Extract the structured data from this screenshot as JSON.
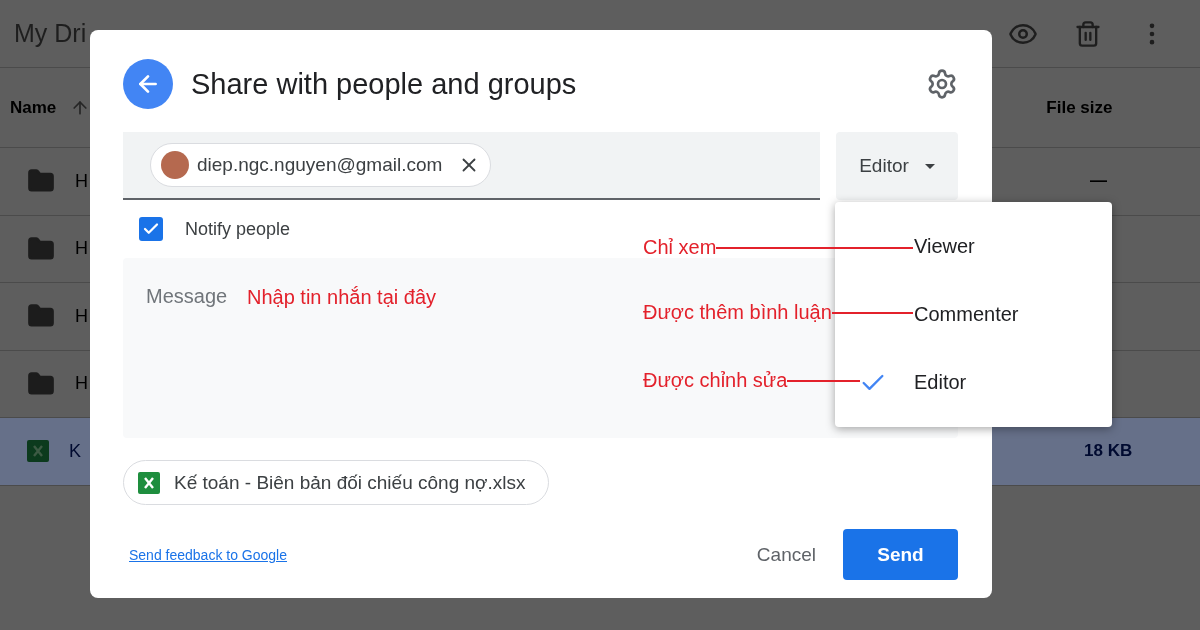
{
  "background": {
    "breadcrumb": "My Dri",
    "columns": {
      "name": "Name",
      "size": "File size"
    },
    "rows": [
      {
        "kind": "folder",
        "name": "H",
        "size": "—",
        "selected": false
      },
      {
        "kind": "folder",
        "name": "H",
        "selected": false
      },
      {
        "kind": "folder",
        "name": "H",
        "selected": false
      },
      {
        "kind": "folder",
        "name": "H",
        "selected": false
      },
      {
        "kind": "spreadsheet",
        "name": "K",
        "size": "18 KB",
        "selected": true
      }
    ]
  },
  "dialog": {
    "title": "Share with people and groups",
    "recipients": [
      {
        "email": "diep.ngc.nguyen@gmail.com"
      }
    ],
    "role": "Editor",
    "notify": {
      "label": "Notify people",
      "checked": true
    },
    "message": {
      "placeholder": "Message"
    },
    "attachment": "Kế toán - Biên bản đối chiếu công nợ.xlsx",
    "feedback_link": "Send feedback to Google",
    "buttons": {
      "cancel": "Cancel",
      "send": "Send"
    }
  },
  "role_menu": [
    {
      "label": "Viewer",
      "selected": false
    },
    {
      "label": "Commenter",
      "selected": false
    },
    {
      "label": "Editor",
      "selected": true
    }
  ],
  "annotations": [
    {
      "kind": "note",
      "text": "Nhập tin nhắn tại đây"
    },
    {
      "kind": "pointer",
      "text": "Chỉ xem"
    },
    {
      "kind": "pointer",
      "text": "Được thêm bình luận"
    },
    {
      "kind": "pointer",
      "text": "Được chỉnh sửa"
    }
  ]
}
